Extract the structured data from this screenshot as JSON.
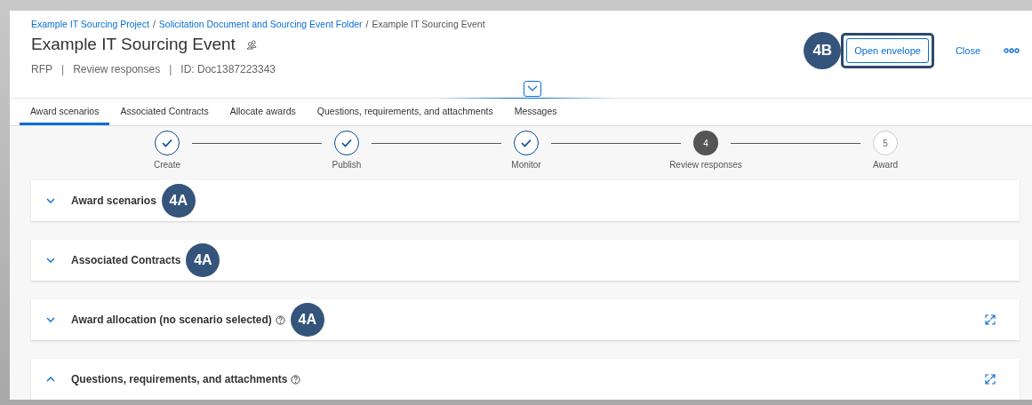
{
  "breadcrumb": [
    {
      "label": "Example IT Sourcing Project",
      "link": true
    },
    {
      "label": "Solicitation Document and Sourcing Event Folder",
      "link": true
    },
    {
      "label": "Example IT Sourcing Event",
      "link": false
    }
  ],
  "breadcrumb_separator": "/",
  "title": "Example IT Sourcing Event",
  "subtitle_separator": "|",
  "subtitle": [
    "RFP",
    "Review responses",
    "ID: Doc1387223343"
  ],
  "header_actions": {
    "callout": "4B",
    "primary": "Open envelope",
    "secondary": "Close"
  },
  "tabs": [
    {
      "label": "Award scenarios",
      "selected": true
    },
    {
      "label": "Associated Contracts",
      "selected": false
    },
    {
      "label": "Allocate awards",
      "selected": false
    },
    {
      "label": "Questions, requirements, and attachments",
      "selected": false
    },
    {
      "label": "Messages",
      "selected": false
    }
  ],
  "steps": [
    {
      "label": "Create",
      "kind": "done"
    },
    {
      "label": "Publish",
      "kind": "done"
    },
    {
      "label": "Monitor",
      "kind": "done"
    },
    {
      "label": "Review responses",
      "kind": "current",
      "number": "4"
    },
    {
      "label": "Award",
      "kind": "upcoming",
      "number": "5"
    }
  ],
  "sections": [
    {
      "title": "Award scenarios",
      "expanded": false,
      "help": false,
      "fullscreen": false,
      "callout": "4A"
    },
    {
      "title": "Associated Contracts",
      "expanded": false,
      "help": false,
      "fullscreen": false,
      "callout": "4A"
    },
    {
      "title": "Award allocation (no scenario selected)",
      "expanded": false,
      "help": true,
      "fullscreen": true,
      "callout": "4A"
    },
    {
      "title": "Questions, requirements, and attachments",
      "expanded": true,
      "help": true,
      "fullscreen": true
    }
  ]
}
